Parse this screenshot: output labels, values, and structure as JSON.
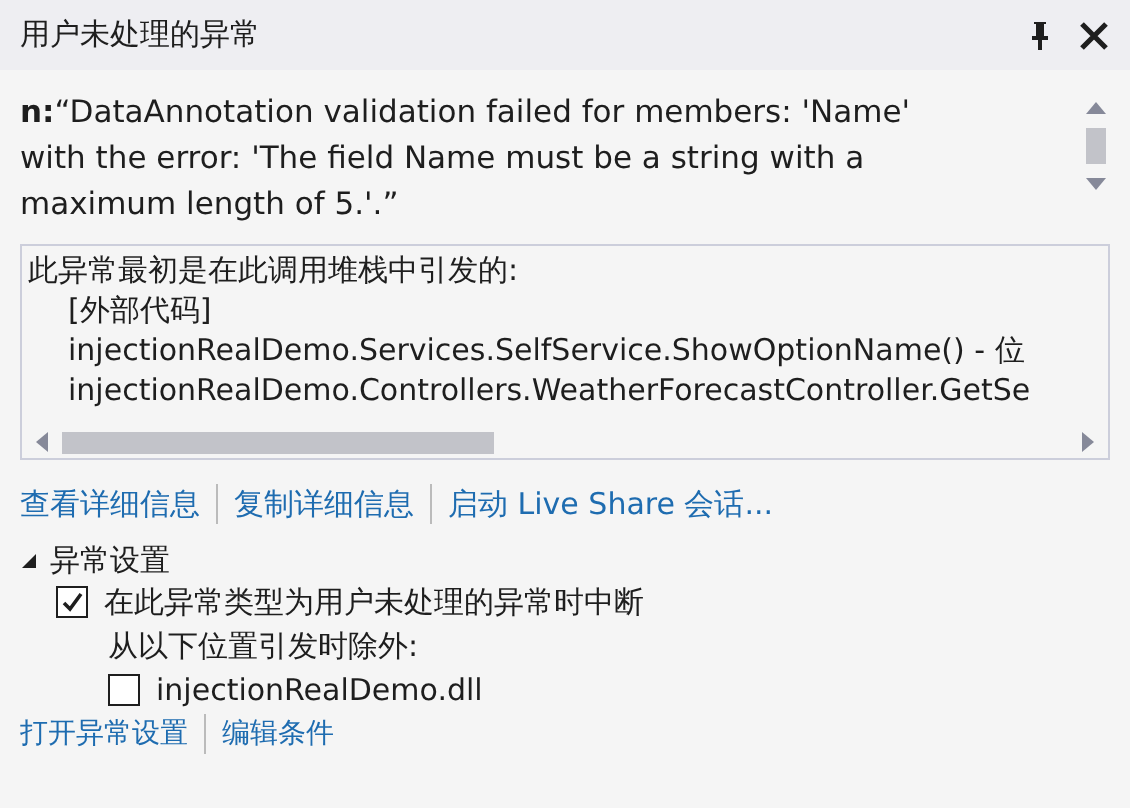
{
  "window": {
    "title": "用户未处理的异常"
  },
  "message": {
    "prefix": "n:",
    "text": "“DataAnnotation validation failed for members: 'Name' with the error: 'The field Name must be a string with a maximum length of 5.'.”"
  },
  "stack": {
    "heading": "此异常最初是在此调用堆栈中引发的:",
    "lines": [
      "[外部代码]",
      "injectionRealDemo.Services.SelfService.ShowOptionName() - 位",
      "injectionRealDemo.Controllers.WeatherForecastController.GetSe"
    ]
  },
  "links": [
    "查看详细信息",
    "复制详细信息",
    "启动 Live Share 会话..."
  ],
  "settings": {
    "title": "异常设置",
    "expanded": true,
    "break_option": {
      "label": "在此异常类型为用户未处理的异常时中断",
      "checked": true
    },
    "except_label": "从以下位置引发时除外:",
    "modules": [
      {
        "label": "injectionRealDemo.dll",
        "checked": false
      }
    ]
  },
  "bottom_links": [
    "打开异常设置",
    "编辑条件"
  ]
}
